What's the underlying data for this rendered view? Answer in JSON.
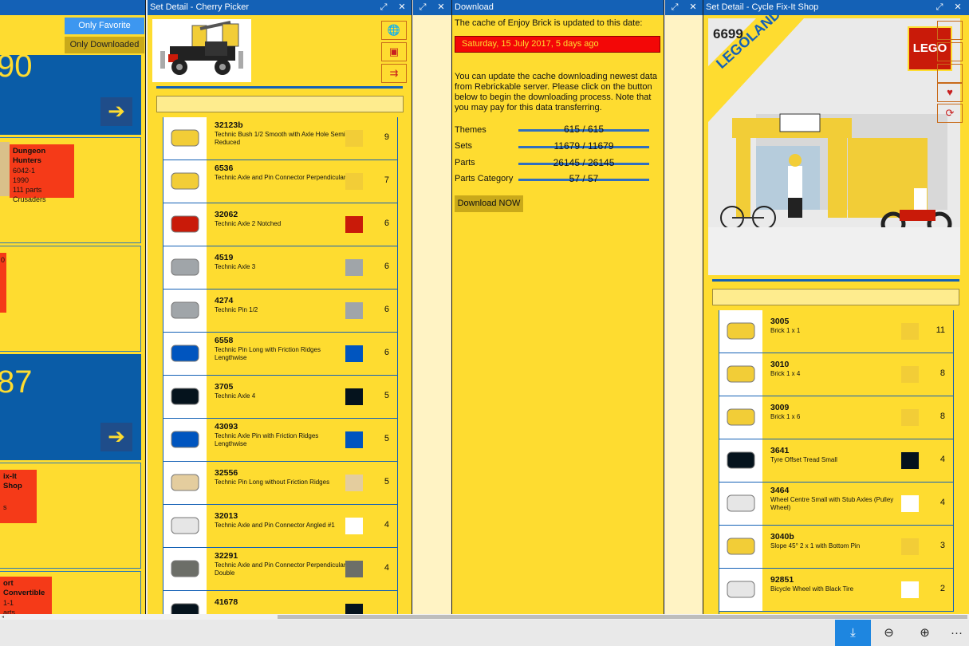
{
  "left_panel": {
    "only_favorite": "Only Favorite",
    "only_downloaded": "Only Downloaded",
    "big_numbers": [
      "90",
      "87"
    ],
    "sets": [
      {
        "title": "Dungeon Hunters",
        "lines": [
          "6042-1",
          "1990",
          "111 parts",
          "Crusaders"
        ]
      },
      {
        "title": "",
        "lines": [
          "0"
        ]
      },
      {
        "title": "ix-It Shop",
        "lines": [
          "s"
        ]
      },
      {
        "title": "ort Convertible",
        "lines": [
          "1-1",
          "",
          "arts"
        ]
      }
    ]
  },
  "cherry": {
    "title": "Set Detail - Cherry Picker",
    "parts": [
      {
        "id": "32123b",
        "name": "Technic Bush 1/2 Smooth with Axle Hole Semi-Reduced",
        "qty": "9",
        "color": "#f2cd37"
      },
      {
        "id": "6536",
        "name": "Technic Axle and Pin Connector Perpendicular",
        "qty": "7",
        "color": "#f2cd37"
      },
      {
        "id": "32062",
        "name": "Technic Axle 2 Notched",
        "qty": "6",
        "color": "#c91a09"
      },
      {
        "id": "4519",
        "name": "Technic Axle 3",
        "qty": "6",
        "color": "#a0a5a9"
      },
      {
        "id": "4274",
        "name": "Technic Pin 1/2",
        "qty": "6",
        "color": "#a0a5a9"
      },
      {
        "id": "6558",
        "name": "Technic Pin Long with Friction Ridges Lengthwise",
        "qty": "6",
        "color": "#0055bf"
      },
      {
        "id": "3705",
        "name": "Technic Axle 4",
        "qty": "5",
        "color": "#05131d"
      },
      {
        "id": "43093",
        "name": "Technic Axle Pin with Friction Ridges Lengthwise",
        "qty": "5",
        "color": "#0055bf"
      },
      {
        "id": "32556",
        "name": "Technic Pin Long without Friction Ridges",
        "qty": "5",
        "color": "#e4cd9e"
      },
      {
        "id": "32013",
        "name": "Technic Axle and Pin Connector Angled #1",
        "qty": "4",
        "color": "#ffffff"
      },
      {
        "id": "32291",
        "name": "Technic Axle and Pin Connector Perpendicular Double",
        "qty": "4",
        "color": "#6c6e68"
      },
      {
        "id": "41678",
        "name": "",
        "qty": "",
        "color": "#05131d"
      }
    ]
  },
  "download": {
    "title": "Download",
    "cache_text": "The cache of Enjoy Brick is updated to this date:",
    "date": "Saturday, 15 July 2017, 5 days ago",
    "desc": "You can update the cache downloading newest data from Rebrickable server. Please click on the button below to begin the downloading process. Note that you may pay for this data transferring.",
    "stats": [
      {
        "label": "Themes",
        "value": "615 / 615"
      },
      {
        "label": "Sets",
        "value": "11679 / 11679"
      },
      {
        "label": "Parts",
        "value": "26145 / 26145"
      },
      {
        "label": "Parts Category",
        "value": "57 / 57"
      }
    ],
    "button": "Download NOW"
  },
  "cycle": {
    "title": "Set Detail - Cycle Fix-It Shop",
    "box_number": "6699",
    "box_brand": "LEGOLAND",
    "box_logo": "LEGO",
    "parts": [
      {
        "id": "3005",
        "name": "Brick 1 x 1",
        "qty": "11",
        "color": "#f2cd37"
      },
      {
        "id": "3010",
        "name": "Brick 1 x 4",
        "qty": "8",
        "color": "#f2cd37"
      },
      {
        "id": "3009",
        "name": "Brick 1 x 6",
        "qty": "8",
        "color": "#f2cd37"
      },
      {
        "id": "3641",
        "name": "Tyre Offset Tread Small",
        "qty": "4",
        "color": "#05131d"
      },
      {
        "id": "3464",
        "name": "Wheel Centre Small with Stub Axles (Pulley Wheel)",
        "qty": "4",
        "color": "#ffffff"
      },
      {
        "id": "3040b",
        "name": "Slope 45° 2 x 1 with Bottom Pin",
        "qty": "3",
        "color": "#f2cd37"
      },
      {
        "id": "92851",
        "name": "Bicycle Wheel with Black Tire",
        "qty": "2",
        "color": "#ffffff"
      }
    ]
  },
  "icons": {
    "expand": "⤢",
    "close": "✕",
    "globe": "🌐",
    "save": "▣",
    "parts": "⇉",
    "heart": "♥",
    "refresh": "⟳",
    "download": "⤓",
    "zoom_out": "⊖",
    "zoom_in": "⊕",
    "more": "···"
  }
}
